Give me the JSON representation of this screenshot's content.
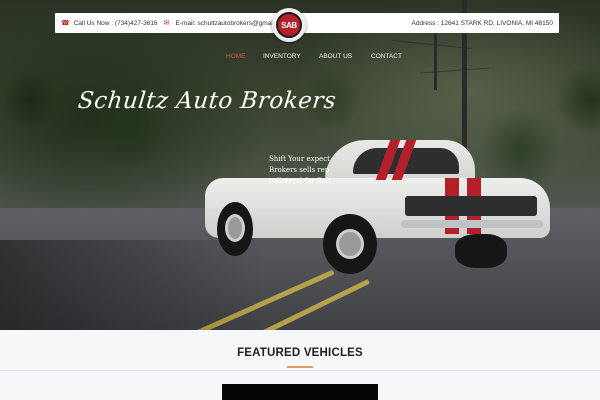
{
  "topbar": {
    "phone_label": "Call Us Now : (734)427-3616",
    "email_label": "E-mail: schultzautobrokers@gmail.com",
    "address_label": "Address : 12641 STARK RD, LIVONIA, MI 48150"
  },
  "logo": {
    "text": "SAB"
  },
  "nav": {
    "items": [
      "HOME",
      "INVENTORY",
      "ABOUT US",
      "CONTACT"
    ],
    "active": "HOME",
    "active_color": "#d9534f"
  },
  "hero": {
    "script_title": "Schultz Auto Brokers",
    "text_lines": [
      "Shift Your expect",
      "Brokers sells rep",
      "collateral for Ban"
    ]
  },
  "featured": {
    "title": "FEATURED VEHICLES",
    "underline_color": "#e0a060"
  },
  "colors": {
    "brand_red": "#b3202a"
  },
  "icons": [
    "phone-icon",
    "mail-icon"
  ]
}
